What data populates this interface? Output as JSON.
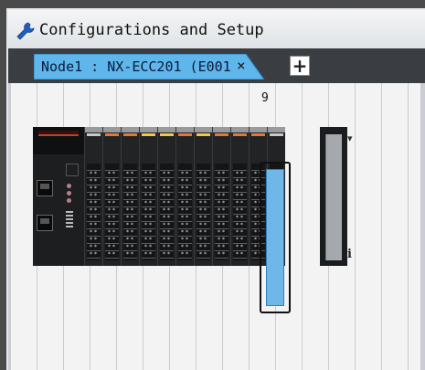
{
  "window": {
    "title": "Configurations and Setup",
    "title_icon": "wrench-icon"
  },
  "tabs": [
    {
      "label": "Node1 : NX-ECC201 (E001",
      "close_glyph": "×",
      "active": true
    }
  ],
  "add_tab_glyph": "+",
  "rack": {
    "selected_slot_number": "9",
    "info_glyph": "i",
    "collapse_glyph": "▾",
    "led_colors": [
      "#c8c8c8",
      "#e07a3a",
      "#e07a3a",
      "#f2c64a",
      "#f2c64a",
      "#e07a3a",
      "#f2c64a",
      "#e07a3a",
      "#e07a3a",
      "#e07a3a",
      "#c8c8c8"
    ]
  },
  "colors": {
    "tab_active": "#5fb6ea",
    "selection": "#6fb7e8",
    "canvas": "#f3f3f3"
  }
}
